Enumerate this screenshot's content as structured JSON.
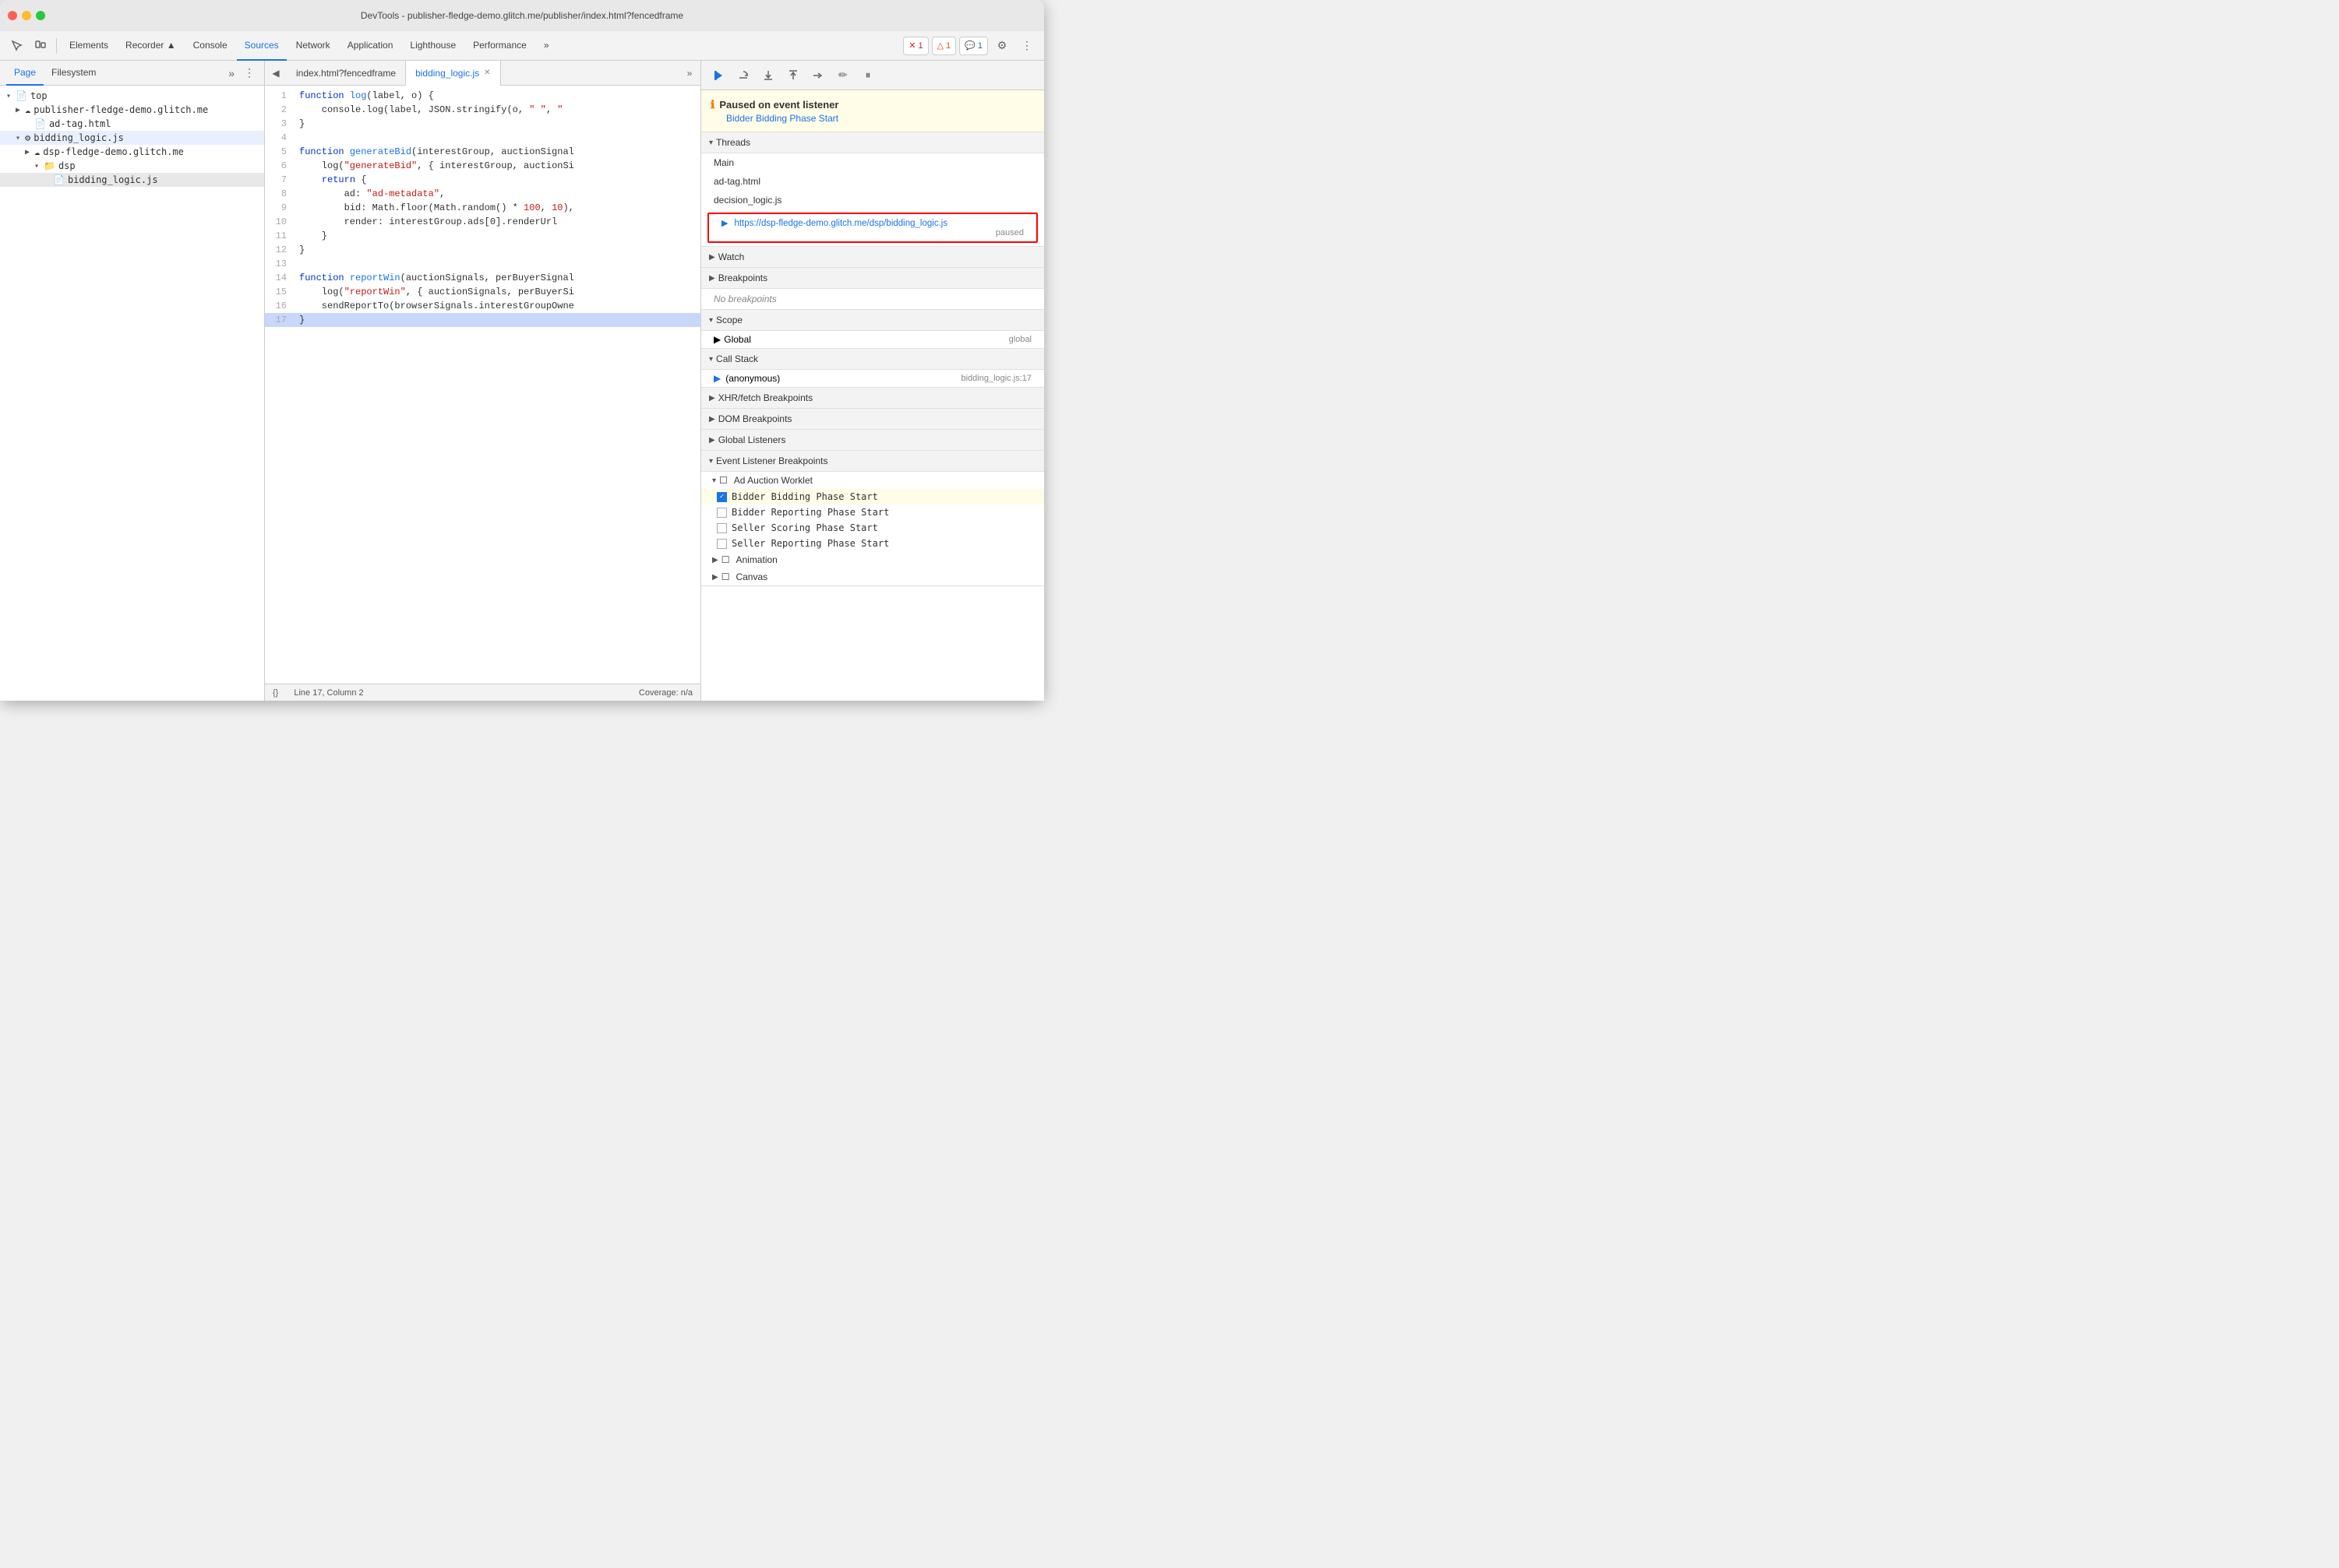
{
  "titleBar": {
    "title": "DevTools - publisher-fledge-demo.glitch.me/publisher/index.html?fencedframe"
  },
  "toolbar": {
    "tabs": [
      {
        "label": "Elements",
        "active": false
      },
      {
        "label": "Recorder ▲",
        "active": false
      },
      {
        "label": "Console",
        "active": false
      },
      {
        "label": "Sources",
        "active": true
      },
      {
        "label": "Network",
        "active": false
      },
      {
        "label": "Application",
        "active": false
      },
      {
        "label": "Lighthouse",
        "active": false
      },
      {
        "label": "Performance",
        "active": false
      }
    ],
    "more": "»",
    "badges": {
      "error": "1",
      "warn": "1",
      "info": "1"
    }
  },
  "leftPanel": {
    "tabs": [
      "Page",
      "Filesystem"
    ],
    "more": "»",
    "kebab": "⋮",
    "tree": [
      {
        "indent": 0,
        "arrow": "▾",
        "icon": "📄",
        "label": "top",
        "type": "root"
      },
      {
        "indent": 1,
        "arrow": "▶",
        "icon": "☁",
        "label": "publisher-fledge-demo.glitch.me",
        "type": "domain"
      },
      {
        "indent": 2,
        "arrow": "",
        "icon": "📄",
        "label": "ad-tag.html",
        "type": "file"
      },
      {
        "indent": 1,
        "arrow": "▾",
        "icon": "⚙",
        "label": "bidding_logic.js",
        "type": "worklet",
        "selected": true
      },
      {
        "indent": 2,
        "arrow": "▶",
        "icon": "☁",
        "label": "dsp-fledge-demo.glitch.me",
        "type": "domain"
      },
      {
        "indent": 3,
        "arrow": "▾",
        "icon": "📁",
        "label": "dsp",
        "type": "folder"
      },
      {
        "indent": 4,
        "arrow": "",
        "icon": "📄",
        "label": "bidding_logic.js",
        "type": "file",
        "active": true
      }
    ]
  },
  "editorTabs": [
    {
      "label": "index.html?fencedframe",
      "active": false,
      "closeable": false
    },
    {
      "label": "bidding_logic.js",
      "active": true,
      "closeable": true
    }
  ],
  "codeLines": [
    {
      "num": 1,
      "content": "function log(label, o) {"
    },
    {
      "num": 2,
      "content": "    console.log(label, JSON.stringify(o, \" \", \""
    },
    {
      "num": 3,
      "content": "}"
    },
    {
      "num": 4,
      "content": ""
    },
    {
      "num": 5,
      "content": "function generateBid(interestGroup, auctionSignal"
    },
    {
      "num": 6,
      "content": "    log(\"generateBid\", { interestGroup, auctionSi"
    },
    {
      "num": 7,
      "content": "    return {"
    },
    {
      "num": 8,
      "content": "        ad: \"ad-metadata\","
    },
    {
      "num": 9,
      "content": "        bid: Math.floor(Math.random() * 100, 10),"
    },
    {
      "num": 10,
      "content": "        render: interestGroup.ads[0].renderUrl"
    },
    {
      "num": 11,
      "content": "    }"
    },
    {
      "num": 12,
      "content": "}"
    },
    {
      "num": 13,
      "content": ""
    },
    {
      "num": 14,
      "content": "function reportWin(auctionSignals, perBuyerSignal"
    },
    {
      "num": 15,
      "content": "    log(\"reportWin\", { auctionSignals, perBuyerSi"
    },
    {
      "num": 16,
      "content": "    sendReportTo(browserSignals.interestGroupOwne"
    },
    {
      "num": 17,
      "content": "}",
      "highlighted": true
    }
  ],
  "statusBar": {
    "formatBtn": "{}",
    "position": "Line 17, Column 2",
    "coverage": "Coverage: n/a"
  },
  "debugPanel": {
    "resumeBtn": "▶",
    "stepOverBtn": "↷",
    "stepIntoBtn": "↓",
    "stepOutBtn": "↑",
    "stepBtn": "→",
    "editBtn": "✏",
    "pauseBtn": "⏸",
    "paused": {
      "title": "Paused on event listener",
      "subtitle": "Bidder Bidding Phase Start"
    },
    "threads": {
      "header": "Threads",
      "items": [
        {
          "label": "Main",
          "active": false
        },
        {
          "label": "ad-tag.html",
          "active": false
        },
        {
          "label": "decision_logic.js",
          "active": false
        },
        {
          "url": "https://dsp-fledge-demo.glitch.me/dsp/bidding_logic.js",
          "paused": "paused",
          "active": true
        }
      ]
    },
    "watch": {
      "header": "Watch"
    },
    "breakpoints": {
      "header": "Breakpoints",
      "empty": "No breakpoints"
    },
    "scope": {
      "header": "Scope",
      "items": [
        {
          "label": "Global",
          "value": "global"
        }
      ]
    },
    "callStack": {
      "header": "Call Stack",
      "items": [
        {
          "label": "(anonymous)",
          "file": "bidding_logic.js:17"
        }
      ]
    },
    "xhrBreakpoints": {
      "header": "XHR/fetch Breakpoints"
    },
    "domBreakpoints": {
      "header": "DOM Breakpoints"
    },
    "globalListeners": {
      "header": "Global Listeners"
    },
    "eventListenerBreakpoints": {
      "header": "Event Listener Breakpoints",
      "groups": [
        {
          "label": "Ad Auction Worklet",
          "expanded": true,
          "items": [
            {
              "label": "Bidder Bidding Phase Start",
              "checked": true,
              "highlighted": true
            },
            {
              "label": "Bidder Reporting Phase Start",
              "checked": false
            },
            {
              "label": "Seller Scoring Phase Start",
              "checked": false
            },
            {
              "label": "Seller Reporting Phase Start",
              "checked": false
            }
          ]
        },
        {
          "label": "Animation",
          "expanded": false
        },
        {
          "label": "Canvas",
          "expanded": false
        }
      ]
    }
  }
}
